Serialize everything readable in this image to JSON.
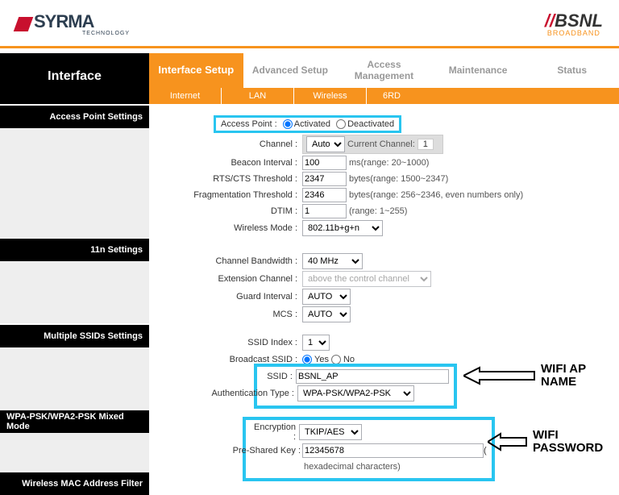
{
  "header": {
    "logo_left": "SYRMA",
    "logo_left_sub": "TECHNOLOGY",
    "logo_right": "BSNL",
    "logo_right_sub": "BROADBAND"
  },
  "sidebar": {
    "title": "Interface",
    "sections": [
      "Access Point Settings",
      "11n Settings",
      "Multiple SSIDs Settings",
      "WPA-PSK/WPA2-PSK Mixed Mode",
      "Wireless MAC Address Filter"
    ]
  },
  "tabs": [
    "Interface Setup",
    "Advanced Setup",
    "Access Management",
    "Maintenance",
    "Status"
  ],
  "subtabs": [
    "Internet",
    "LAN",
    "Wireless",
    "6RD"
  ],
  "ap": {
    "access_point_label": "Access Point :",
    "radio_activated": "Activated",
    "radio_deactivated": "Deactivated",
    "channel_label": "Channel :",
    "channel_value": "Auto",
    "channel_hint": "Current Channel:",
    "channel_cur": "1",
    "beacon_label": "Beacon Interval :",
    "beacon_value": "100",
    "beacon_hint": "ms(range: 20~1000)",
    "rts_label": "RTS/CTS Threshold :",
    "rts_value": "2347",
    "rts_hint": "bytes(range: 1500~2347)",
    "frag_label": "Fragmentation Threshold :",
    "frag_value": "2346",
    "frag_hint": "bytes(range: 256~2346, even numbers only)",
    "dtim_label": "DTIM :",
    "dtim_value": "1",
    "dtim_hint": "(range: 1~255)",
    "wmode_label": "Wireless Mode :",
    "wmode_value": "802.11b+g+n"
  },
  "n11": {
    "bw_label": "Channel Bandwidth :",
    "bw_value": "40 MHz",
    "ext_label": "Extension Channel :",
    "ext_value": "above the control channel",
    "guard_label": "Guard Interval :",
    "guard_value": "AUTO",
    "mcs_label": "MCS :",
    "mcs_value": "AUTO"
  },
  "ssid": {
    "index_label": "SSID Index :",
    "index_value": "1",
    "broadcast_label": "Broadcast SSID :",
    "radio_yes": "Yes",
    "radio_no": "No",
    "ssid_label": "SSID :",
    "ssid_value": "BSNL_AP",
    "auth_label": "Authentication Type :",
    "auth_value": "WPA-PSK/WPA2-PSK"
  },
  "wpa": {
    "enc_label": "Encryption :",
    "enc_value": "TKIP/AES",
    "psk_label": "Pre-Shared Key :",
    "psk_value": "12345678",
    "psk_hint": "hexadecimal characters)"
  },
  "annot": {
    "ap_name": "WIFI AP NAME",
    "password": "WIFI PASSWORD"
  }
}
